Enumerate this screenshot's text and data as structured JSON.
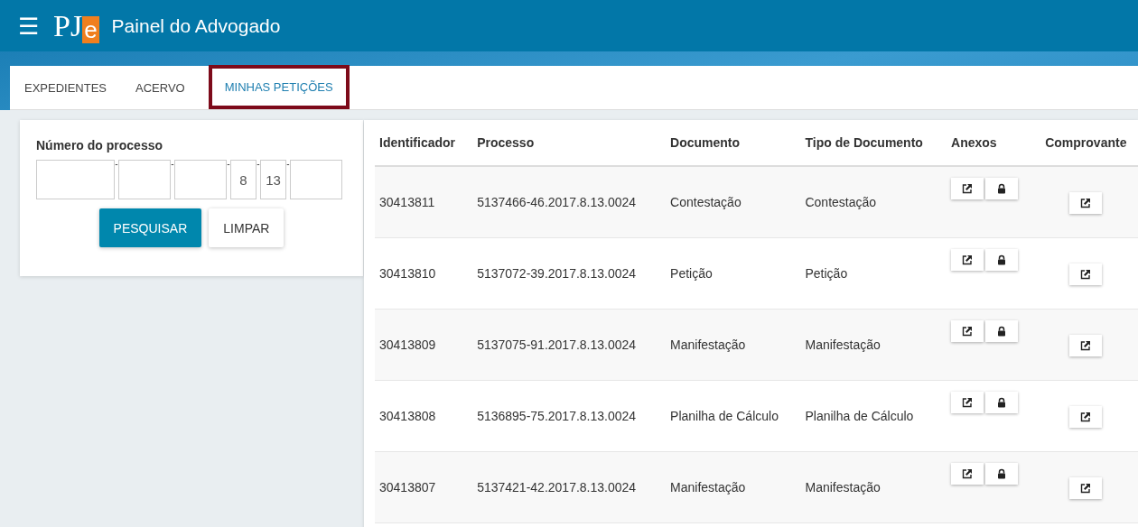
{
  "header": {
    "menu_icon": "☰",
    "logo": {
      "main": "PJ",
      "accent": "e"
    },
    "title": "Painel do Advogado"
  },
  "tabs": [
    {
      "label": "EXPEDIENTES",
      "selected": false
    },
    {
      "label": "ACERVO",
      "selected": false
    },
    {
      "label": "MINHAS PETIÇÕES",
      "selected": true
    }
  ],
  "search": {
    "label": "Número do processo",
    "fields": [
      {
        "kind": "long"
      },
      {
        "kind": "medium"
      },
      {
        "kind": "medium"
      },
      {
        "kind": "short",
        "value": "8"
      },
      {
        "kind": "short",
        "value": "13"
      },
      {
        "kind": "medium"
      }
    ],
    "separator": "-",
    "buttons": [
      {
        "label": "PESQUISAR",
        "kind": "primary"
      },
      {
        "label": "LIMPAR",
        "kind": "default"
      }
    ]
  },
  "table": {
    "columns": [
      "Identificador",
      "Processo",
      "Documento",
      "Tipo de Documento",
      "Anexos",
      "Comprovante"
    ],
    "rows": [
      {
        "id": "30413811",
        "processo": "5137466-46.2017.8.13.0024",
        "documento": "Contestação",
        "tipo": "Contestação"
      },
      {
        "id": "30413810",
        "processo": "5137072-39.2017.8.13.0024",
        "documento": "Petição",
        "tipo": "Petição"
      },
      {
        "id": "30413809",
        "processo": "5137075-91.2017.8.13.0024",
        "documento": "Manifestação",
        "tipo": "Manifestação"
      },
      {
        "id": "30413808",
        "processo": "5136895-75.2017.8.13.0024",
        "documento": "Planilha de Cálculo",
        "tipo": "Planilha de Cálculo"
      },
      {
        "id": "30413807",
        "processo": "5137421-42.2017.8.13.0024",
        "documento": "Manifestação",
        "tipo": "Manifestação"
      }
    ]
  }
}
